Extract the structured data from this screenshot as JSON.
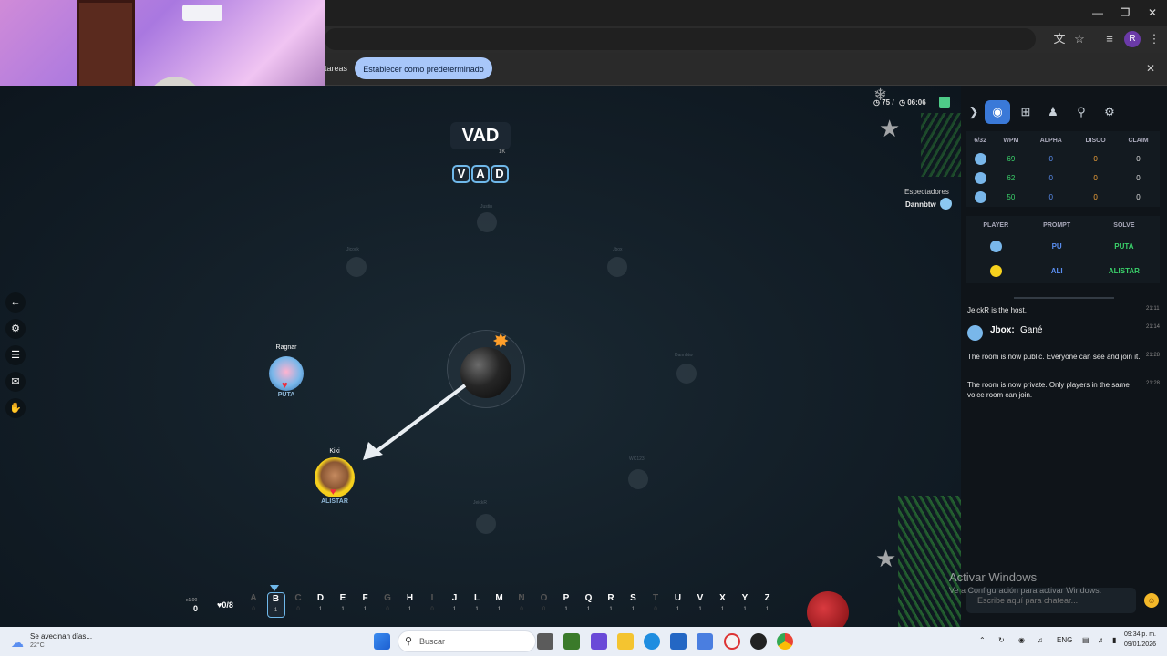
{
  "browser": {
    "infobar_text": "tareas",
    "set_default": "Establecer como predeterminado",
    "profile_initial": "R"
  },
  "game": {
    "timer_left": "75",
    "timer_right": "06:06",
    "prompt": "VAD",
    "prompt_count": "1K",
    "prompt_letters": [
      "V",
      "A",
      "D"
    ],
    "spectators_label": "Espectadores",
    "spectator_name": "Dannbtw",
    "players": [
      {
        "name": "Ragnar",
        "word": "PUTA"
      },
      {
        "name": "Kiki",
        "word": "ALISTAR"
      }
    ],
    "ghost_names": [
      "Justin",
      "Jicock",
      "Jbox",
      "Dannbtw",
      "WC123",
      "JeickR"
    ],
    "multiplier": "x1.00",
    "multiplier_value": "0",
    "hearts": "♥0/8",
    "letters": [
      {
        "ch": "A",
        "n": "0",
        "off": true
      },
      {
        "ch": "B",
        "n": "1",
        "off": false,
        "sel": true
      },
      {
        "ch": "C",
        "n": "0",
        "off": true
      },
      {
        "ch": "D",
        "n": "1",
        "off": false
      },
      {
        "ch": "E",
        "n": "1",
        "off": false
      },
      {
        "ch": "F",
        "n": "1",
        "off": false
      },
      {
        "ch": "G",
        "n": "0",
        "off": true
      },
      {
        "ch": "H",
        "n": "1",
        "off": false
      },
      {
        "ch": "I",
        "n": "0",
        "off": true
      },
      {
        "ch": "J",
        "n": "1",
        "off": false
      },
      {
        "ch": "L",
        "n": "1",
        "off": false
      },
      {
        "ch": "M",
        "n": "1",
        "off": false
      },
      {
        "ch": "N",
        "n": "0",
        "off": true
      },
      {
        "ch": "O",
        "n": "0",
        "off": true
      },
      {
        "ch": "P",
        "n": "1",
        "off": false
      },
      {
        "ch": "Q",
        "n": "1",
        "off": false
      },
      {
        "ch": "R",
        "n": "1",
        "off": false
      },
      {
        "ch": "S",
        "n": "1",
        "off": false
      },
      {
        "ch": "T",
        "n": "0",
        "off": true
      },
      {
        "ch": "U",
        "n": "1",
        "off": false
      },
      {
        "ch": "V",
        "n": "1",
        "off": false
      },
      {
        "ch": "X",
        "n": "1",
        "off": false
      },
      {
        "ch": "Y",
        "n": "1",
        "off": false
      },
      {
        "ch": "Z",
        "n": "1",
        "off": false
      }
    ]
  },
  "panel": {
    "stats_headers": [
      "6/32",
      "WPM",
      "ALPHA",
      "DISCO",
      "CLAIM"
    ],
    "stats_rows": [
      [
        "69",
        "0",
        "0",
        "0"
      ],
      [
        "62",
        "0",
        "0",
        "0"
      ],
      [
        "50",
        "0",
        "0",
        "0"
      ]
    ],
    "words_headers": [
      "PLAYER",
      "PROMPT",
      "SOLVE"
    ],
    "words_rows": [
      {
        "prompt": "PU",
        "solve": "PUTA"
      },
      {
        "prompt": "ALI",
        "solve": "ALISTAR"
      }
    ],
    "chat": [
      {
        "text": "JeickR is the host.",
        "time": "21:11"
      },
      {
        "author": "Jbox:",
        "text": "Gané",
        "time": "21:14"
      },
      {
        "text": "The room is now public. Everyone can see and join it.",
        "time": "21:28"
      },
      {
        "text": "The room is now private. Only players in the same voice room can join.",
        "time": "21:28"
      }
    ],
    "chat_placeholder": "Escribe aquí para chatear...",
    "activate_title": "Activar Windows",
    "activate_sub": "Ve a Configuración para activar Windows."
  },
  "taskbar": {
    "weather_text": "Se avecinan días...",
    "weather_temp": "22°C",
    "search_placeholder": "Buscar",
    "lang": "ENG",
    "time": "09:34 p. m.",
    "date": "09/01/2026"
  },
  "colors": {
    "accent": "#3a79d8",
    "green": "#3ad16a",
    "blue_stat": "#5a8ef0",
    "orange_stat": "#f0a23a"
  }
}
